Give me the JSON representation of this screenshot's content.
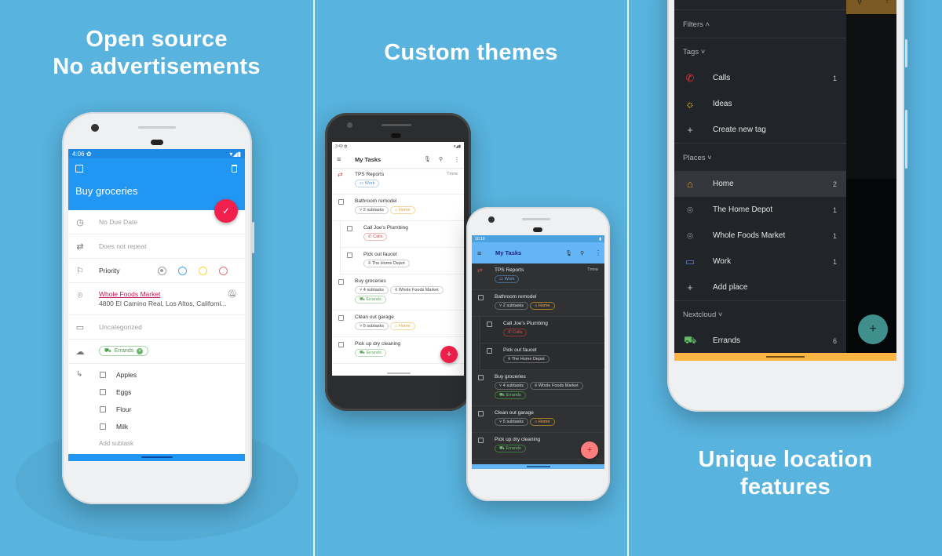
{
  "panels": [
    {
      "headline_lines": [
        "Open source",
        "No advertisements"
      ],
      "phone": {
        "status_time": "4:06",
        "task_title": "Buy groceries",
        "rows": {
          "due": "No Due Date",
          "repeat": "Does not repeat",
          "priority_label": "Priority",
          "location_name": "Whole Foods Market",
          "location_address": "4800 El Camino Real, Los Altos, Californi...",
          "category": "Uncategorized",
          "list_chip": "Errands"
        },
        "subtasks": [
          "Apples",
          "Eggs",
          "Flour",
          "Milk"
        ],
        "add_subtask": "Add subtask",
        "priority_colors": [
          "#9e9e9e",
          "#42a5f5",
          "#fdd835",
          "#e57373"
        ],
        "accent": "#2196f3",
        "fab_color": "#f01f4b"
      }
    },
    {
      "headline_lines": [
        "Custom themes"
      ],
      "light_phone": {
        "status_time": "3:49",
        "toolbar_title": "My Tasks",
        "tasks": [
          {
            "name": "TPS Reports",
            "due": "Tmrw",
            "chips": [
              {
                "label": "Work",
                "type": "work"
              }
            ]
          },
          {
            "name": "Bathroom remodel",
            "chips": [
              {
                "label": "2 subtasks",
                "type": "sub"
              },
              {
                "label": "Home",
                "type": "home"
              }
            ]
          },
          {
            "name": "Call Joe's Plumbing",
            "chips": [
              {
                "label": "Calls",
                "type": "calls"
              }
            ]
          },
          {
            "name": "Pick out faucet",
            "chips": [
              {
                "label": "The Home Depot",
                "type": "place"
              }
            ]
          },
          {
            "name": "Buy groceries",
            "chips": [
              {
                "label": "4 subtasks",
                "type": "sub"
              },
              {
                "label": "Whole Foods Market",
                "type": "place"
              },
              {
                "label": "Errands",
                "type": "errands"
              }
            ]
          },
          {
            "name": "Clean out garage",
            "chips": [
              {
                "label": "5 subtasks",
                "type": "sub"
              },
              {
                "label": "Home",
                "type": "home"
              }
            ]
          },
          {
            "name": "Pick up dry cleaning",
            "chips": [
              {
                "label": "Errands",
                "type": "errands"
              }
            ]
          }
        ]
      },
      "dark_phone": {
        "status_time": "10:10",
        "toolbar_title": "My Tasks",
        "toolbar_color": "#64b5f6",
        "fab_color": "#ff7d7d"
      }
    },
    {
      "headline_lines": [
        "Unique location",
        "features"
      ],
      "drawer": {
        "filters_label": "Filters",
        "tags_label": "Tags",
        "tags": [
          {
            "label": "Calls",
            "count": "1",
            "icon": "phone-icon",
            "color": "#e53935"
          },
          {
            "label": "Ideas",
            "count": "",
            "icon": "lightbulb-icon",
            "color": "#fdd835"
          },
          {
            "label": "Create new tag",
            "count": "",
            "icon": "plus-icon",
            "color": "#bdbdbd"
          }
        ],
        "places_label": "Places",
        "places": [
          {
            "label": "Home",
            "count": "2",
            "icon": "home-icon",
            "color": "#e0a030",
            "selected": true
          },
          {
            "label": "The Home Depot",
            "count": "1",
            "icon": "pin-icon",
            "color": "#bdbdbd"
          },
          {
            "label": "Whole Foods Market",
            "count": "1",
            "icon": "pin-icon",
            "color": "#bdbdbd"
          },
          {
            "label": "Work",
            "count": "1",
            "icon": "briefcase-icon",
            "color": "#5c7fc2"
          },
          {
            "label": "Add place",
            "count": "",
            "icon": "plus-icon",
            "color": "#bdbdbd"
          }
        ],
        "nextcloud_label": "Nextcloud",
        "nextcloud": [
          {
            "label": "Errands",
            "count": "6",
            "icon": "car-icon",
            "color": "#66bb6a"
          }
        ],
        "fab_color": "#3f8f8c",
        "accent": "#ffb443"
      }
    }
  ]
}
